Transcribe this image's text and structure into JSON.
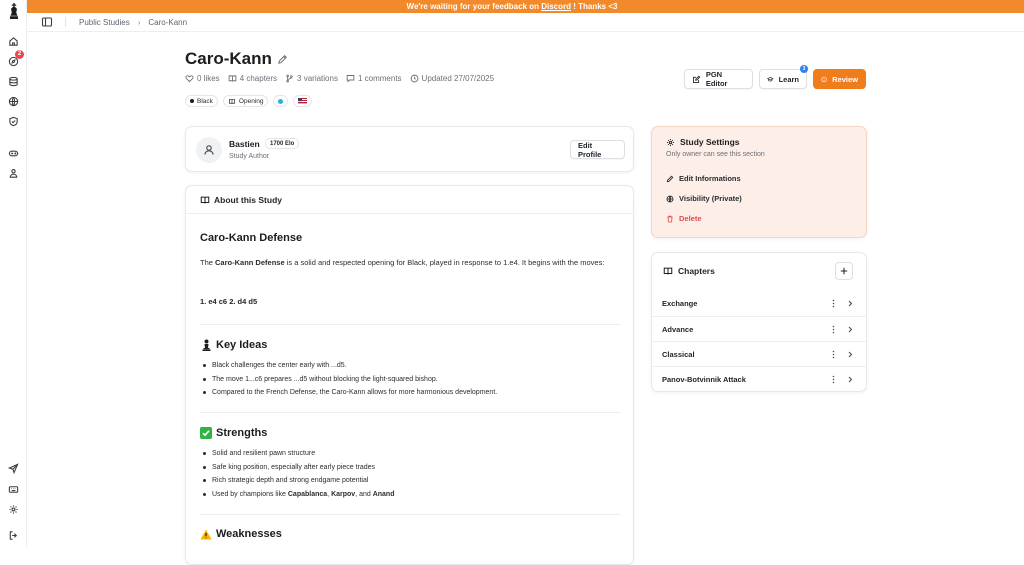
{
  "banner": {
    "prefix": "We're waiting for your feedback on ",
    "link": "Discord",
    "suffix": " ! Thanks <3"
  },
  "rail": {
    "notification_count": "2"
  },
  "breadcrumb": [
    "Public Studies",
    "Caro-Kann"
  ],
  "study": {
    "title": "Caro-Kann",
    "likes": "0 likes",
    "chapters_count": "4 chapters",
    "variations": "3 variations",
    "comments": "1 comments",
    "updated": "Updated 27/07/2025",
    "tags": [
      "Black",
      "Opening"
    ]
  },
  "actions": {
    "pgn_editor": "PGN Editor",
    "learn": "Learn",
    "learn_badge": "3",
    "review": "Review"
  },
  "author": {
    "name": "Bastien",
    "elo": "1700 Elo",
    "role": "Study Author",
    "edit_profile": "Edit Profile"
  },
  "about": {
    "heading": "About this Study",
    "title": "Caro-Kann Defense",
    "intro_pre": "The ",
    "intro_bold": "Caro-Kann Defense",
    "intro_post": " is a solid and respected opening for Black, played in response to 1.e4. It begins with the moves:",
    "moves": "1. e4 c6 2. d4 d5",
    "key_ideas_title": "Key Ideas",
    "key_ideas": [
      "Black challenges the center early with ...d5.",
      "The move 1...c6 prepares ...d5 without blocking the light-squared bishop.",
      "Compared to the French Defense, the Caro-Kann allows for more harmonious development."
    ],
    "strengths_title": "Strengths",
    "strengths": [
      "Solid and resilient pawn structure",
      "Safe king position, especially after early piece trades",
      "Rich strategic depth and strong endgame potential"
    ],
    "champions_pre": "Used by champions like ",
    "champion_1": "Capablanca",
    "champion_2": "Karpov",
    "champions_and": ", and ",
    "champion_3": "Anand",
    "weaknesses_title": "Weaknesses"
  },
  "settings": {
    "title": "Study Settings",
    "subtitle": "Only owner can see this section",
    "edit": "Edit Informations",
    "visibility": "Visibility (Private)",
    "delete": "Delete"
  },
  "chapters": {
    "title": "Chapters",
    "items": [
      "Exchange",
      "Advance",
      "Classical",
      "Panov-Botvinnik Attack"
    ]
  },
  "colors": {
    "accent": "#f07d1c",
    "banner": "#f2892b",
    "danger": "#e5484d",
    "settings_bg": "#fdeee7"
  }
}
